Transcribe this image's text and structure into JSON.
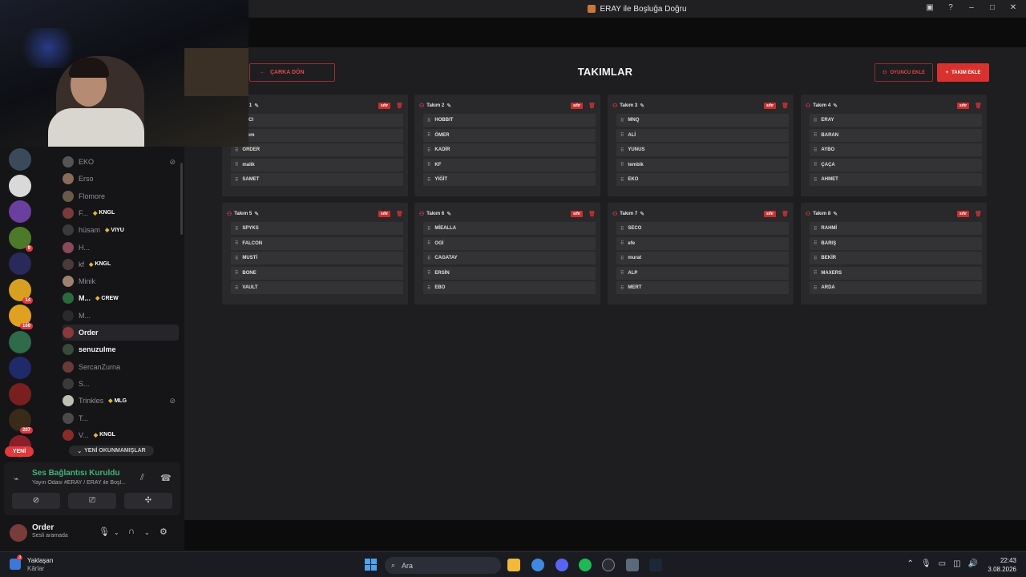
{
  "window": {
    "title": "ERAY ile Boşluğa Doğru"
  },
  "header": {
    "back_label": "ÇARKA DÖN",
    "title": "TAKIMLAR",
    "add_player_label": "OYUNCU EKLE",
    "add_team_label": "TAKIM EKLE"
  },
  "teams": [
    {
      "name": "Takım 1",
      "badge": "sıfır",
      "players": [
        "…ICI",
        "…om",
        "ORDER",
        "malik",
        "SAMET"
      ]
    },
    {
      "name": "Takım 2",
      "badge": "sıfır",
      "players": [
        "HOBBIT",
        "ÖMER",
        "KADİR",
        "KF",
        "YİĞİT"
      ]
    },
    {
      "name": "Takım 3",
      "badge": "sıfır",
      "players": [
        "MNQ",
        "ALİ",
        "YUNUS",
        "tembik",
        "EKO"
      ]
    },
    {
      "name": "Takım 4",
      "badge": "sıfır",
      "players": [
        "ERAY",
        "BARAN",
        "AYBO",
        "ÇAÇA",
        "AHMET"
      ]
    },
    {
      "name": "Takım 5",
      "badge": "sıfır",
      "players": [
        "SPYKS",
        "FALCON",
        "MUSTİ",
        "BONE",
        "VAULT"
      ]
    },
    {
      "name": "Takım 6",
      "badge": "sıfır",
      "players": [
        "MİEALLA",
        "OGİ",
        "CAGATAY",
        "ERSİN",
        "EBO"
      ]
    },
    {
      "name": "Takım 7",
      "badge": "sıfır",
      "players": [
        "SECO",
        "efe",
        "murat",
        "ALP",
        "MERT"
      ]
    },
    {
      "name": "Takım 8",
      "badge": "sıfır",
      "players": [
        "RAHMİ",
        "BARIŞ",
        "BEKİR",
        "MAXERS",
        "ARDA"
      ]
    }
  ],
  "servers": [
    {
      "badge": "",
      "color": "#3a4a5a"
    },
    {
      "badge": "",
      "color": "#d9d9d9"
    },
    {
      "badge": "",
      "color": "#6a3fa0"
    },
    {
      "badge": "9",
      "color": "#4d7a2a"
    },
    {
      "badge": "",
      "color": "#2a2a5a"
    },
    {
      "badge": "14",
      "color": "#d8a020"
    },
    {
      "badge": "168",
      "color": "#e0a020"
    },
    {
      "badge": "",
      "color": "#2f6a4a"
    },
    {
      "badge": "",
      "color": "#1f2a6a"
    },
    {
      "badge": "",
      "color": "#7a1f1f"
    },
    {
      "badge": "207",
      "color": "#3a2a1a"
    },
    {
      "badge": "",
      "color": "#8a1f2a"
    }
  ],
  "new_label": "YENİ",
  "members": [
    {
      "name": "EKO",
      "tag": "",
      "bright": false,
      "muted": true,
      "color": "#555"
    },
    {
      "name": "Erso",
      "tag": "",
      "bright": false,
      "muted": false,
      "color": "#8a6a5a"
    },
    {
      "name": "Flomore",
      "tag": "",
      "bright": false,
      "muted": false,
      "color": "#6a5a4a"
    },
    {
      "name": "F...",
      "tag": "KNGL",
      "bright": false,
      "muted": false,
      "color": "#7a3a3a"
    },
    {
      "name": "hüsam",
      "tag": "VIYU",
      "bright": false,
      "muted": false,
      "color": "#3a3a3a"
    },
    {
      "name": "H...",
      "tag": "",
      "bright": false,
      "muted": false,
      "color": "#8a4a5a"
    },
    {
      "name": "kf",
      "tag": "KNGL",
      "bright": false,
      "muted": false,
      "color": "#4a3a3a"
    },
    {
      "name": "Minik",
      "tag": "",
      "bright": false,
      "muted": false,
      "color": "#a08070"
    },
    {
      "name": "M...",
      "tag": "CREW",
      "bright": true,
      "muted": false,
      "color": "#2a6a3a"
    },
    {
      "name": "M...",
      "tag": "",
      "bright": false,
      "muted": false,
      "color": "#2a2a2a"
    },
    {
      "name": "Order",
      "tag": "",
      "bright": true,
      "muted": false,
      "color": "#8a3a3a"
    },
    {
      "name": "senuzulme",
      "tag": "",
      "bright": true,
      "muted": false,
      "color": "#3a4a3a"
    },
    {
      "name": "SercanZurna",
      "tag": "",
      "bright": false,
      "muted": false,
      "color": "#6a3a3a"
    },
    {
      "name": "S...",
      "tag": "",
      "bright": false,
      "muted": false,
      "color": "#3a3a3a"
    },
    {
      "name": "Trinkles",
      "tag": "MLG",
      "bright": false,
      "muted": true,
      "color": "#c0c0b0"
    },
    {
      "name": "T...",
      "tag": "",
      "bright": false,
      "muted": false,
      "color": "#4a4a4a"
    },
    {
      "name": "V...",
      "tag": "KNGL",
      "bright": false,
      "muted": false,
      "color": "#8a2a2a"
    }
  ],
  "unread_label": "YENİ OKUNMAMIŞLAR",
  "voice": {
    "status": "Ses Bağlantısı Kuruldu",
    "channel": "Yayın Odası #ERAY / ERAY ile Boşl..."
  },
  "user": {
    "name": "Order",
    "status": "Sesli aramada"
  },
  "taskbar": {
    "weather_line1": "Yaklaşan",
    "weather_line2": "Kârlar",
    "weather_badge": "3",
    "search_placeholder": "Ara",
    "time": "22:43",
    "date": "3.08.2026"
  }
}
